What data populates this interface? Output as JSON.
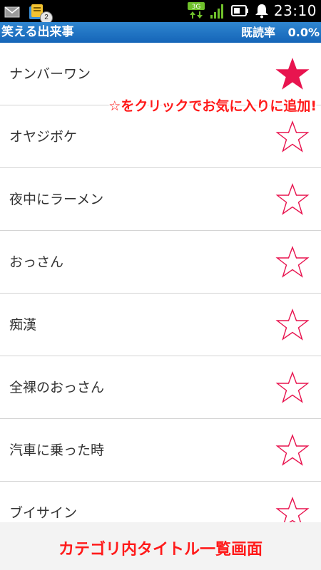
{
  "status_bar": {
    "notification_badge": "2",
    "network_type": "3G",
    "time": "23:10",
    "icons": [
      "mail-icon",
      "app-notification-icon",
      "3g-data-icon",
      "signal-icon",
      "battery-icon",
      "bell-icon"
    ]
  },
  "title_bar": {
    "app_title": "笑える出来事",
    "read_rate_label": "既読率",
    "read_rate_value": "0.0%",
    "color": "#1a6fc2"
  },
  "list": {
    "items": [
      {
        "title": "ナンバーワン",
        "favorite": true
      },
      {
        "title": "オヤジボケ",
        "favorite": false
      },
      {
        "title": "夜中にラーメン",
        "favorite": false
      },
      {
        "title": "おっさん",
        "favorite": false
      },
      {
        "title": "痴漢",
        "favorite": false
      },
      {
        "title": "全裸のおっさん",
        "favorite": false
      },
      {
        "title": "汽車に乗った時",
        "favorite": false
      },
      {
        "title": "ブイサイン",
        "favorite": false
      }
    ],
    "star_color": "#e8144f"
  },
  "annotation": {
    "callout": "☆をクリックでお気に入りに追加!",
    "caption": "カテゴリ内タイトル一覧画面",
    "color": "#ff1a1a"
  }
}
